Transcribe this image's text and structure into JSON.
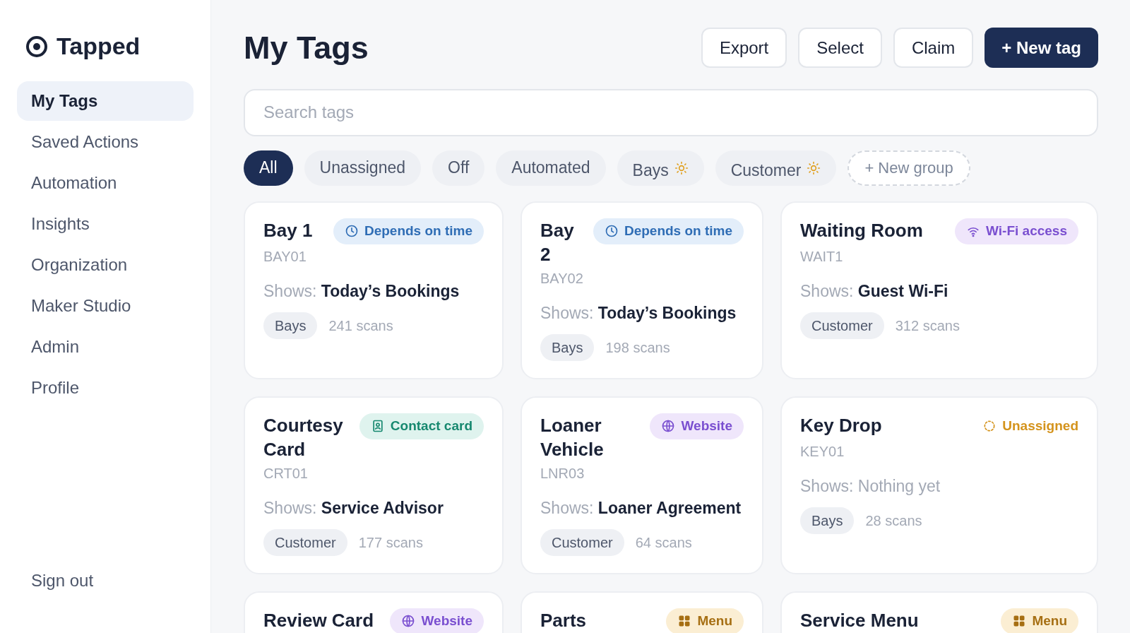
{
  "brand": {
    "name": "Tapped"
  },
  "sidebar": {
    "items": [
      {
        "label": "My Tags",
        "selected": true
      },
      {
        "label": "Saved Actions",
        "selected": false
      },
      {
        "label": "Automation",
        "selected": false
      },
      {
        "label": "Insights",
        "selected": false
      },
      {
        "label": "Organization",
        "selected": false
      },
      {
        "label": "Maker Studio",
        "selected": false
      },
      {
        "label": "Admin",
        "selected": false
      },
      {
        "label": "Profile",
        "selected": false
      }
    ],
    "sign_out": "Sign out"
  },
  "header": {
    "title": "My Tags",
    "buttons": [
      {
        "label": "Export",
        "kind": "outline"
      },
      {
        "label": "Select",
        "kind": "outline"
      },
      {
        "label": "Claim",
        "kind": "outline"
      },
      {
        "label": "+ New tag",
        "kind": "primary"
      }
    ]
  },
  "search": {
    "placeholder": "Search tags"
  },
  "filters": [
    {
      "label": "All",
      "selected": true,
      "automated": false
    },
    {
      "label": "Unassigned",
      "selected": false,
      "automated": false
    },
    {
      "label": "Off",
      "selected": false,
      "automated": false
    },
    {
      "label": "Automated",
      "selected": false,
      "automated": false
    },
    {
      "label": "Bays",
      "selected": false,
      "automated": true
    },
    {
      "label": "Customer",
      "selected": false,
      "automated": true
    }
  ],
  "new_group": "+ New group",
  "cards": [
    {
      "title": "Bay 1",
      "badge": {
        "kind": "time",
        "label": "Depends on time"
      },
      "code": "BAY01",
      "shows_label": "Shows:",
      "shows": "Today’s Bookings",
      "assigned": true,
      "group": "Bays",
      "scans": "241 scans"
    },
    {
      "title": "Bay 2",
      "badge": {
        "kind": "time",
        "label": "Depends on time"
      },
      "code": "BAY02",
      "shows_label": "Shows:",
      "shows": "Today’s Bookings",
      "assigned": true,
      "group": "Bays",
      "scans": "198 scans"
    },
    {
      "title": "Waiting Room",
      "badge": {
        "kind": "wifi",
        "label": "Wi-Fi access"
      },
      "code": "WAIT1",
      "shows_label": "Shows:",
      "shows": "Guest Wi-Fi",
      "assigned": true,
      "group": "Customer",
      "scans": "312 scans"
    },
    {
      "title": "Courtesy Card",
      "badge": {
        "kind": "contact",
        "label": "Contact card"
      },
      "code": "CRT01",
      "shows_label": "Shows:",
      "shows": "Service Advisor",
      "assigned": true,
      "group": "Customer",
      "scans": "177 scans"
    },
    {
      "title": "Loaner Vehicle",
      "badge": {
        "kind": "website",
        "label": "Website"
      },
      "code": "LNR03",
      "shows_label": "Shows:",
      "shows": "Loaner Agreement",
      "assigned": true,
      "group": "Customer",
      "scans": "64 scans"
    },
    {
      "title": "Key Drop",
      "badge": {
        "kind": "unassigned",
        "label": "Unassigned"
      },
      "code": "KEY01",
      "shows_label": "Shows:",
      "shows": "Nothing yet",
      "assigned": false,
      "group": "Bays",
      "scans": "28 scans"
    },
    {
      "title": "Review Card",
      "badge": {
        "kind": "website",
        "label": "Website"
      }
    },
    {
      "title": "Parts",
      "badge": {
        "kind": "menu",
        "label": "Menu"
      }
    },
    {
      "title": "Service Menu",
      "badge": {
        "kind": "menu",
        "label": "Menu"
      }
    }
  ]
}
